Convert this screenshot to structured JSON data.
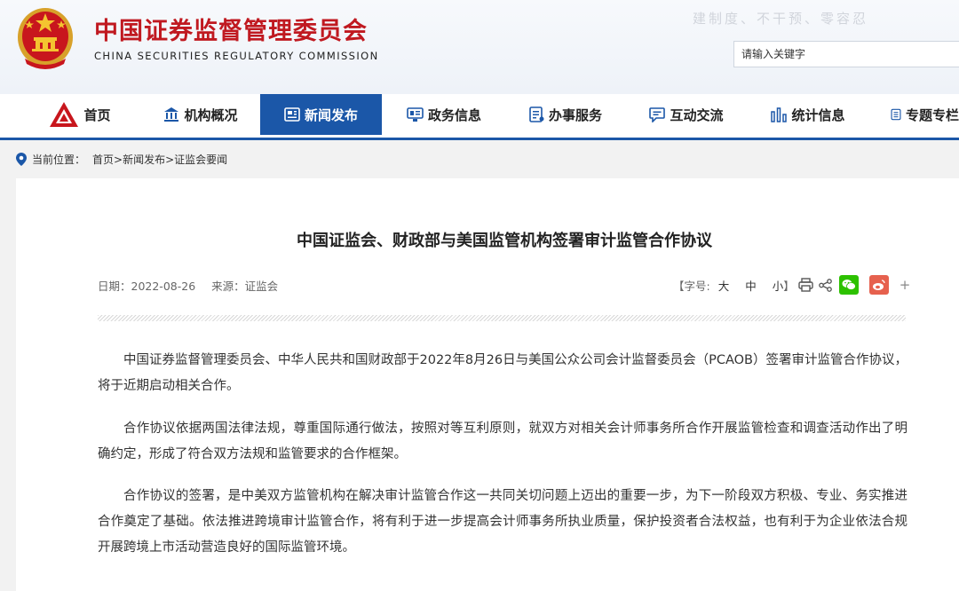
{
  "header": {
    "title_cn": "中国证券监督管理委员会",
    "title_en": "CHINA SECURITIES REGULATORY COMMISSION",
    "slogan": "建制度、不干预、零容忍",
    "search_placeholder": "请输入关键字"
  },
  "nav": {
    "items": [
      {
        "label": "首页",
        "icon": "home-logo-icon"
      },
      {
        "label": "机构概况",
        "icon": "building-icon"
      },
      {
        "label": "新闻发布",
        "icon": "news-icon"
      },
      {
        "label": "政务信息",
        "icon": "monitor-icon"
      },
      {
        "label": "办事服务",
        "icon": "document-list-icon"
      },
      {
        "label": "互动交流",
        "icon": "chat-icon"
      },
      {
        "label": "统计信息",
        "icon": "bar-chart-icon"
      },
      {
        "label": "专题专栏",
        "icon": "notebook-icon"
      }
    ],
    "active_index": 2,
    "accent_color": "#1b57a8"
  },
  "breadcrumb": {
    "prefix": "当前位置：",
    "path": "首页>新闻发布>证监会要闻"
  },
  "article": {
    "title": "中国证监会、财政部与美国监管机构签署审计监管合作协议",
    "date": "日期：2022-08-26",
    "source": "来源：证监会",
    "font_size_label": "【字号:",
    "font_sizes": [
      "大",
      "中",
      "小"
    ],
    "font_size_close": "】",
    "more": "+",
    "paragraphs": [
      "中国证券监督管理委员会、中华人民共和国财政部于2022年8月26日与美国公众公司会计监督委员会（PCAOB）签署审计监管合作协议，将于近期启动相关合作。",
      "合作协议依据两国法律法规，尊重国际通行做法，按照对等互利原则，就双方对相关会计师事务所合作开展监管检查和调查活动作出了明确约定，形成了符合双方法规和监管要求的合作框架。",
      "合作协议的签署，是中美双方监管机构在解决审计监管合作这一共同关切问题上迈出的重要一步，为下一阶段双方积极、专业、务实推进合作奠定了基础。依法推进跨境审计监管合作，将有利于进一步提高会计师事务所执业质量，保护投资者合法权益，也有利于为企业依法合规开展跨境上市活动营造良好的国际监管环境。"
    ]
  },
  "colors": {
    "brand_red": "#c01920",
    "wechat_green": "#2dc100",
    "weibo_red": "#e6614e"
  }
}
